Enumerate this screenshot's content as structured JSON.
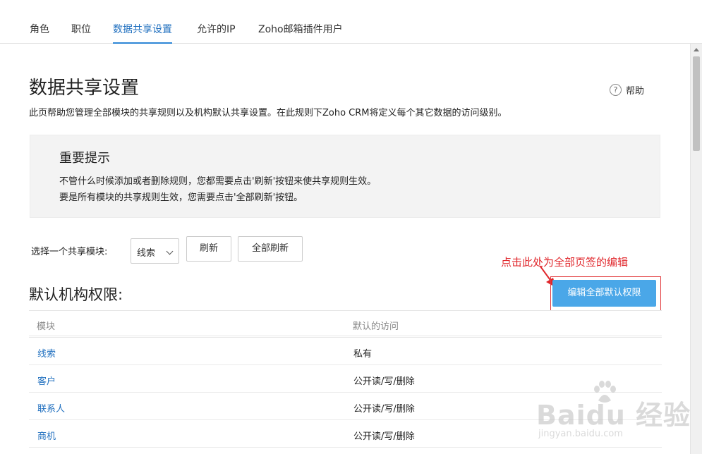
{
  "tabs": [
    {
      "label": "角色",
      "active": false
    },
    {
      "label": "职位",
      "active": false
    },
    {
      "label": "数据共享设置",
      "active": true
    },
    {
      "label": "允许的IP",
      "active": false
    },
    {
      "label": "Zoho邮箱插件用户",
      "active": false
    }
  ],
  "header": {
    "title": "数据共享设置",
    "help_label": "帮助",
    "help_icon": "?",
    "description": "此页帮助您管理全部模块的共享规则以及机构默认共享设置。在此规则下Zoho CRM将定义每个其它数据的访问级别。"
  },
  "notice": {
    "title": "重要提示",
    "lines": [
      "不管什么时候添加或者删除规则，您都需要点击'刷新'按钮来使共享规则生效。",
      "要是所有模块的共享规则生效，您需要点击'全部刷新'按钮。"
    ]
  },
  "module_selector": {
    "label": "选择一个共享模块:",
    "selected": "线索",
    "refresh_label": "刷新",
    "refresh_all_label": "全部刷新"
  },
  "annotation": {
    "text": "点击此处为全部页签的编辑",
    "color": "#e0262b"
  },
  "section": {
    "title": "默认机构权限:",
    "edit_all_label": "编辑全部默认权限"
  },
  "table": {
    "headers": [
      "模块",
      "默认的访问"
    ],
    "rows": [
      {
        "module": "线索",
        "access": "私有"
      },
      {
        "module": "客户",
        "access": "公开读/写/删除"
      },
      {
        "module": "联系人",
        "access": "公开读/写/删除"
      },
      {
        "module": "商机",
        "access": "公开读/写/删除"
      }
    ]
  },
  "watermark": {
    "logo": "Baidu 经验",
    "url": "jingyan.baidu.com"
  },
  "colors": {
    "accent": "#2d86d6",
    "link": "#1f6fbf",
    "primary_button": "#4aa7e8",
    "annotation": "#e0262b"
  }
}
